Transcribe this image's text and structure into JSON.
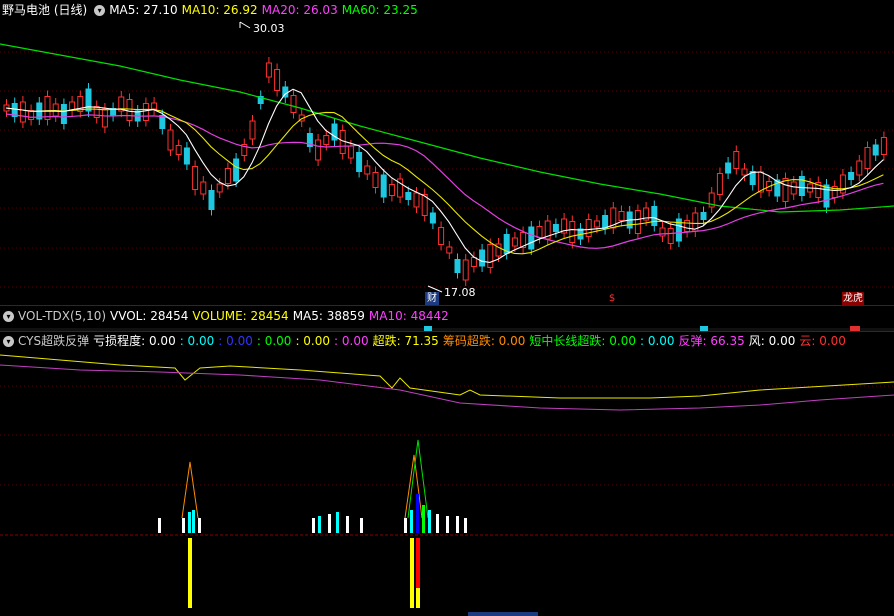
{
  "main": {
    "title": "野马电池 (日线)",
    "ma": [
      {
        "label": "MA5: 27.10",
        "color": "#ffffff"
      },
      {
        "label": "MA10: 26.92",
        "color": "#ffff00"
      },
      {
        "label": "MA20: 26.03",
        "color": "#ff40ff"
      },
      {
        "label": "MA60: 23.25",
        "color": "#00ff00"
      }
    ],
    "high_label": "30.03",
    "low_label": "17.08",
    "markers": [
      {
        "text": "财",
        "color": "#ffffff",
        "bg": "#1c3a80"
      },
      {
        "text": "$",
        "color": "#ff3030",
        "bg": "transparent"
      },
      {
        "text": "龙虎",
        "color": "#ffffff",
        "bg": "#8b0000"
      }
    ]
  },
  "vol": {
    "title": "VOL-TDX(5,10)",
    "items": [
      {
        "label": "VVOL: 28454",
        "color": "#ffffff"
      },
      {
        "label": "VOLUME: 28454",
        "color": "#ffff00"
      },
      {
        "label": "MA5: 38859",
        "color": "#ffffff"
      },
      {
        "label": "MA10: 48442",
        "color": "#ff40ff"
      }
    ]
  },
  "cys": {
    "title": "CYS超跌反弹",
    "items": [
      {
        "label": "亏损程度: 0.00",
        "color": "#ffffff"
      },
      {
        "label": ": 0.00",
        "color": "#00ffff"
      },
      {
        "label": ": 0.00",
        "color": "#0000ff"
      },
      {
        "label": ": 0.00",
        "color": "#00ff00"
      },
      {
        "label": ": 0.00",
        "color": "#ffff00"
      },
      {
        "label": ": 0.00",
        "color": "#ff40ff"
      },
      {
        "label": "超跌: 71.35",
        "color": "#ffff00"
      },
      {
        "label": "筹码超跌: 0.00",
        "color": "#ff8c00"
      },
      {
        "label": "短中长线超跌: 0.00",
        "color": "#00ff00"
      },
      {
        "label": ": 0.00",
        "color": "#00ffff"
      },
      {
        "label": "反弹: 66.35",
        "color": "#ff40ff"
      },
      {
        "label": "风: 0.00",
        "color": "#ffffff"
      },
      {
        "label": "云: 0.00",
        "color": "#ff3030"
      }
    ]
  }
}
